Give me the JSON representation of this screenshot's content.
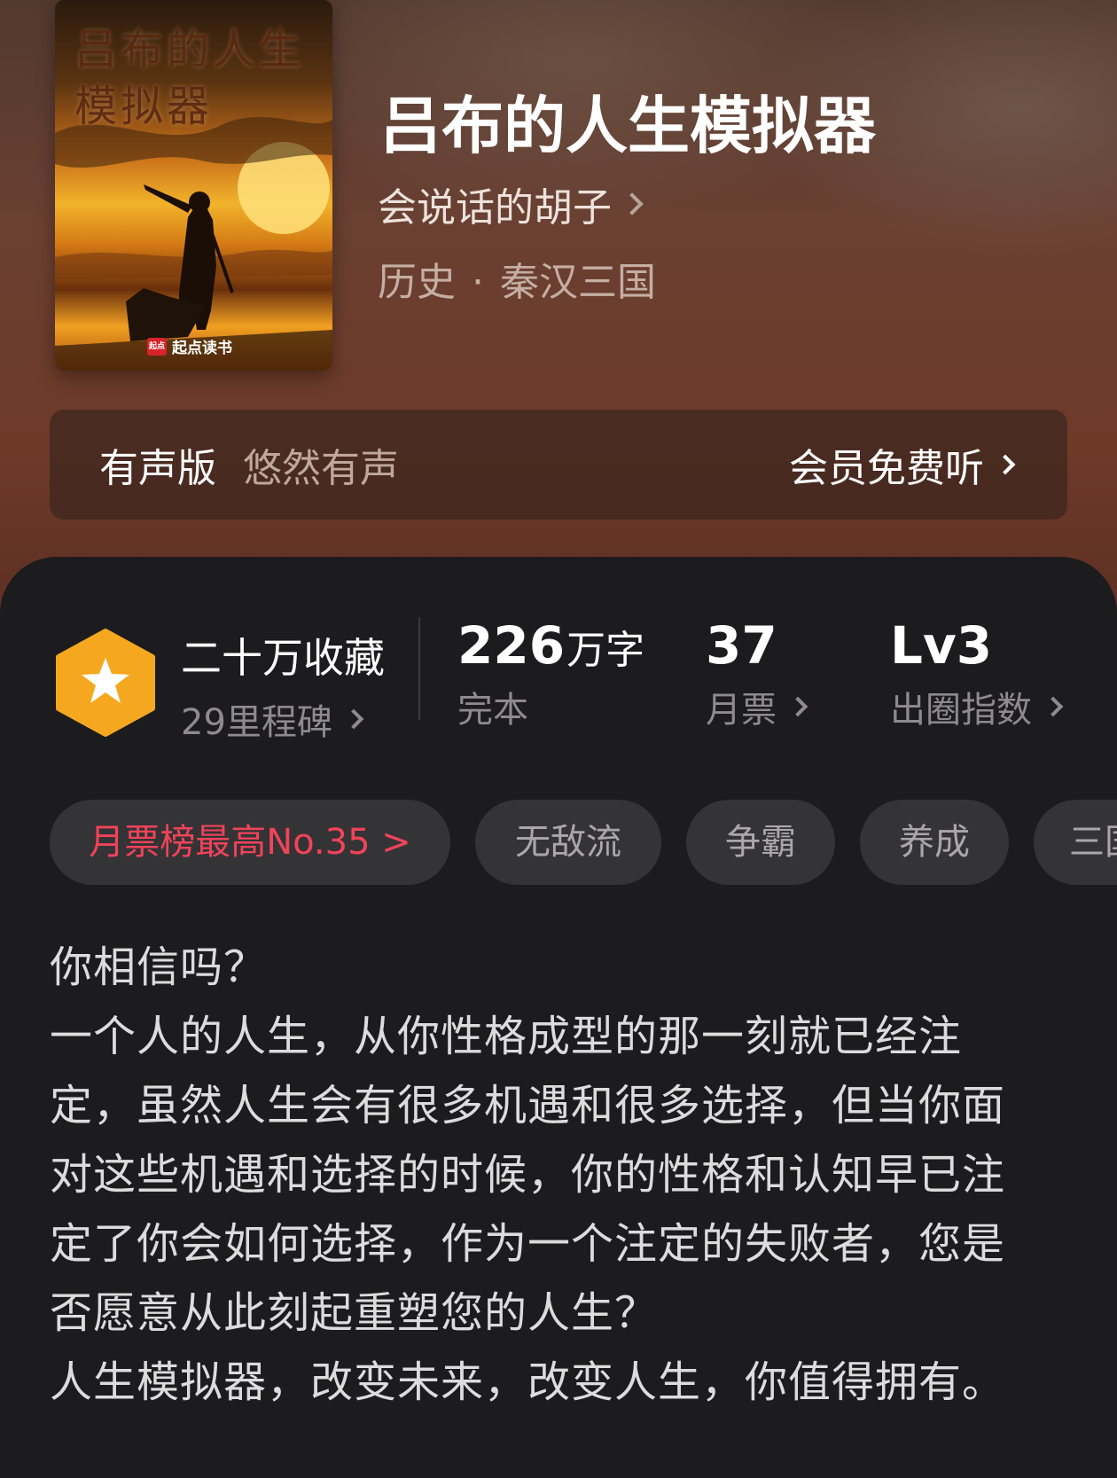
{
  "book": {
    "title": "吕布的人生模拟器",
    "cover_title": "吕布的人生模拟器",
    "cover_publisher": "起点读书",
    "author": "会说话的胡子",
    "category": "历史",
    "subcategory": "秦汉三国"
  },
  "audio": {
    "label": "有声版",
    "narrator": "悠然有声",
    "action": "会员免费听"
  },
  "stats": {
    "collection_title": "二十万收藏",
    "collection_sub": "29里程碑",
    "words_value": "226",
    "words_unit": "万字",
    "words_sub": "完本",
    "tickets_value": "37",
    "tickets_sub": "月票",
    "index_value": "Lv3",
    "index_sub": "出圈指数"
  },
  "tags": [
    {
      "label": "月票榜最高No.35 >"
    },
    {
      "label": "无敌流"
    },
    {
      "label": "争霸"
    },
    {
      "label": "养成"
    },
    {
      "label": "三国"
    }
  ],
  "synopsis": [
    "你相信吗？",
    "一个人的人生，从你性格成型的那一刻就已经注定，虽然人生会有很多机遇和很多选择，但当你面对这些机遇和选择的时候，你的性格和认知早已注定了你会如何选择，作为一个注定的失败者，您是否愿意从此刻起重塑您的人生？",
    "人生模拟器，改变未来，改变人生，你值得拥有。"
  ],
  "colors": {
    "rank_tag": "#f0435a",
    "badge": "#f5a81f",
    "content_bg": "#1c1b1d"
  }
}
